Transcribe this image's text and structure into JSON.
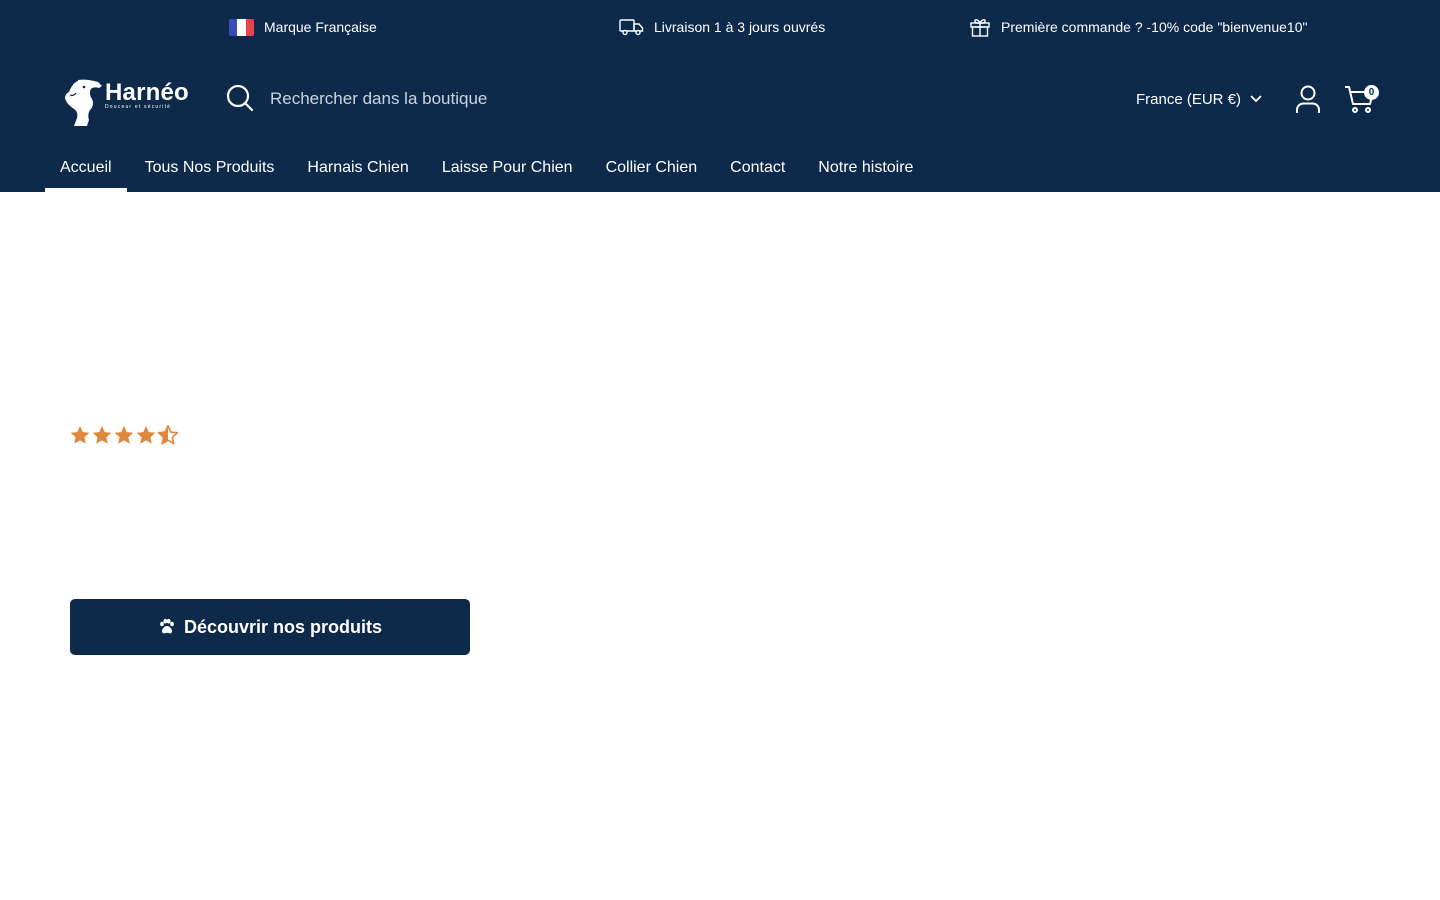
{
  "announcement": {
    "items": [
      {
        "icon": "french-flag-icon",
        "text": "Marque Française"
      },
      {
        "icon": "delivery-truck-icon",
        "text": "Livraison 1 à 3 jours ouvrés"
      },
      {
        "icon": "gift-icon",
        "text": "Première commande ? -10% code \"bienvenue10\""
      }
    ]
  },
  "header": {
    "logo": {
      "name": "Harnéo",
      "tagline": "Douceur et sécurité"
    },
    "search": {
      "placeholder": "Rechercher dans la boutique",
      "value": ""
    },
    "country": "France (EUR €)",
    "cart_count": "0"
  },
  "nav": {
    "items": [
      {
        "label": "Accueil",
        "active": true
      },
      {
        "label": "Tous Nos Produits"
      },
      {
        "label": "Harnais Chien"
      },
      {
        "label": "Laisse Pour Chien"
      },
      {
        "label": "Collier Chien"
      },
      {
        "label": "Contact"
      },
      {
        "label": "Notre histoire"
      }
    ]
  },
  "hero": {
    "rating": 4.5,
    "rating_max": 5,
    "cta_label": "Découvrir nos produits"
  },
  "colors": {
    "navy": "#0d2a4b",
    "star": "#e0883c",
    "white": "#ffffff"
  }
}
